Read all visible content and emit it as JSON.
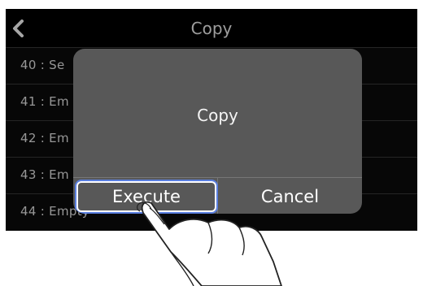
{
  "screen": {
    "title": "Copy",
    "back_icon": "chevron-left-icon"
  },
  "list": {
    "items": [
      {
        "label": "40 : Se"
      },
      {
        "label": "41 : Em"
      },
      {
        "label": "42 : Em"
      },
      {
        "label": "43 : Em"
      },
      {
        "label": "44 : Empty"
      }
    ]
  },
  "dialog": {
    "message": "Copy",
    "execute_label": "Execute",
    "cancel_label": "Cancel"
  },
  "colors": {
    "background": "#0b0b0b",
    "dialog": "#585858",
    "highlight": "#5a7fe0"
  }
}
